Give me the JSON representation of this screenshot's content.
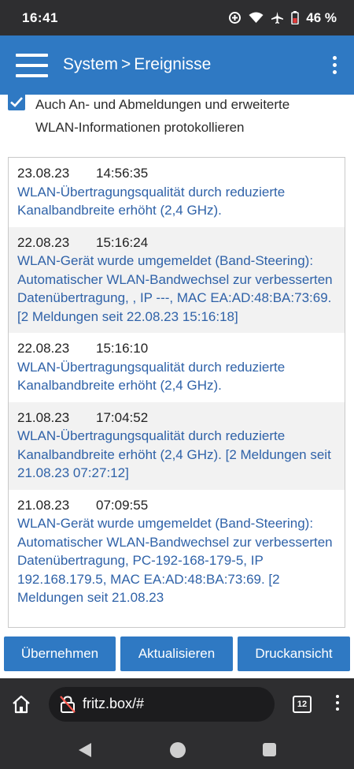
{
  "status": {
    "time": "16:41",
    "battery": "46 %"
  },
  "appbar": {
    "section": "System",
    "separator": ">",
    "page": "Ereignisse"
  },
  "option": {
    "checked": true,
    "text": "Auch An- und Abmeldungen und erweiterte WLAN-Informationen protokollieren"
  },
  "events": [
    {
      "date": "23.08.23",
      "time": "14:56:35",
      "message": "WLAN-Übertragungsqualität durch reduzierte Kanalbandbreite erhöht (2,4 GHz)."
    },
    {
      "date": "22.08.23",
      "time": "15:16:24",
      "message": "WLAN-Gerät wurde umgemeldet (Band-Steering): Automatischer WLAN-Bandwechsel zur verbesserten Datenübertragung, , IP ---, MAC EA:AD:48:BA:73:69. [2 Meldungen seit 22.08.23 15:16:18]"
    },
    {
      "date": "22.08.23",
      "time": "15:16:10",
      "message": "WLAN-Übertragungsqualität durch reduzierte Kanalbandbreite erhöht (2,4 GHz)."
    },
    {
      "date": "21.08.23",
      "time": "17:04:52",
      "message": "WLAN-Übertragungsqualität durch reduzierte Kanalbandbreite erhöht (2,4 GHz). [2 Meldungen seit 21.08.23 07:27:12]"
    },
    {
      "date": "21.08.23",
      "time": "07:09:55",
      "message": "WLAN-Gerät wurde umgemeldet (Band-Steering): Automatischer WLAN-Bandwechsel zur verbesserten Datenübertragung, PC-192-168-179-5, IP 192.168.179.5, MAC EA:AD:48:BA:73:69. [2 Meldungen seit 21.08.23"
    }
  ],
  "buttons": {
    "apply": "Übernehmen",
    "refresh": "Aktualisieren",
    "print": "Druckansicht"
  },
  "browser": {
    "url": "fritz.box/#",
    "tab_count": "12"
  },
  "colors": {
    "accent": "#2f79c3",
    "link": "#2f62a8",
    "dark_bar": "#2e2e30"
  }
}
